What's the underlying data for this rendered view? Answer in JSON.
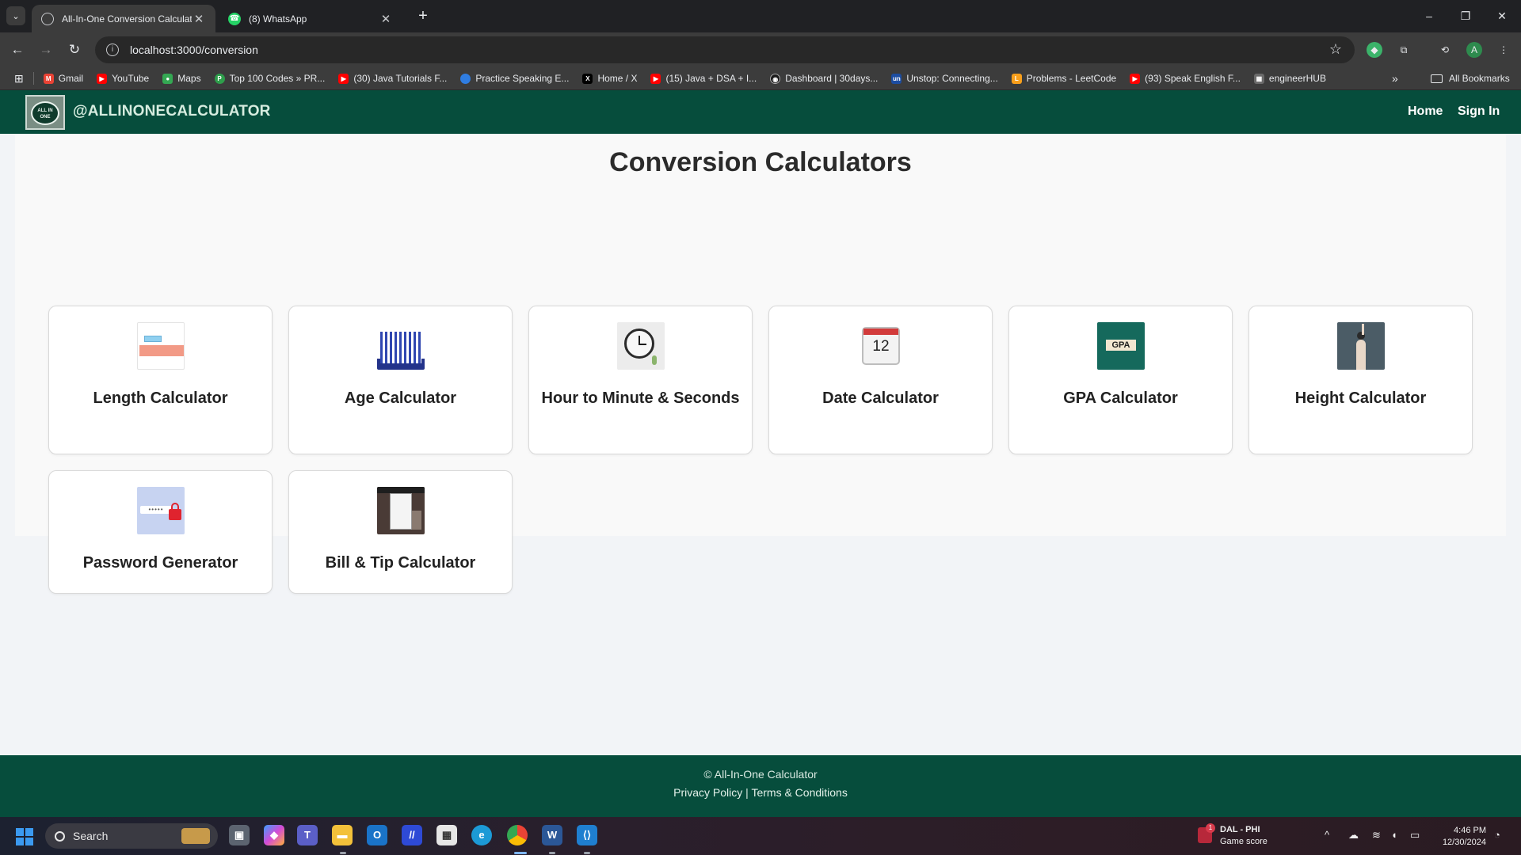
{
  "browser": {
    "tabs": [
      {
        "title": "All-In-One Conversion Calculat",
        "active": true,
        "icon": "globe-icon"
      },
      {
        "title": "(8) WhatsApp",
        "active": false,
        "icon": "whatsapp-icon"
      }
    ],
    "url": "localhost:3000/conversion",
    "profile_initial": "A",
    "bookmarks": [
      {
        "label": "Gmail",
        "icon": "gmail-icon",
        "color": "#ea4335"
      },
      {
        "label": "YouTube",
        "icon": "youtube-icon",
        "color": "#ff0000"
      },
      {
        "label": "Maps",
        "icon": "maps-icon",
        "color": "#34a853"
      },
      {
        "label": "Top 100 Codes » PR...",
        "icon": "code-icon",
        "color": "#2e9e4b"
      },
      {
        "label": "(30) Java Tutorials F...",
        "icon": "youtube-icon",
        "color": "#ff0000"
      },
      {
        "label": "Practice Speaking E...",
        "icon": "globe-icon",
        "color": "#2f7de1"
      },
      {
        "label": "Home / X",
        "icon": "x-icon",
        "color": "#000000"
      },
      {
        "label": "(15) Java + DSA + I...",
        "icon": "youtube-icon",
        "color": "#ff0000"
      },
      {
        "label": "Dashboard | 30days...",
        "icon": "dashboard-icon",
        "color": "#1b1b1b"
      },
      {
        "label": "Unstop: Connecting...",
        "icon": "unstop-icon",
        "color": "#1c4da1"
      },
      {
        "label": "Problems - LeetCode",
        "icon": "leetcode-icon",
        "color": "#f89f1b"
      },
      {
        "label": "(93) Speak English F...",
        "icon": "youtube-icon",
        "color": "#ff0000"
      },
      {
        "label": "engineerHUB",
        "icon": "hub-icon",
        "color": "#6a6a6a"
      }
    ],
    "all_bookmarks": "All Bookmarks"
  },
  "site": {
    "brand": "@ALLINONECALCULATOR",
    "logo_text": "ALL IN ONE",
    "nav": {
      "home": "Home",
      "sign_in": "Sign In"
    },
    "page_title": "Conversion Calculators",
    "cards": [
      {
        "label": "Length Calculator",
        "icon": "ruler-image"
      },
      {
        "label": "Age Calculator",
        "icon": "age-bars-image"
      },
      {
        "label": "Hour to Minute & Seconds",
        "icon": "clock-image"
      },
      {
        "label": "Date Calculator",
        "icon": "calendar-image",
        "icon_text": "12"
      },
      {
        "label": "GPA Calculator",
        "icon": "gpa-image",
        "icon_text": "GPA"
      },
      {
        "label": "Height Calculator",
        "icon": "height-image"
      },
      {
        "label": "Password Generator",
        "icon": "password-lock-image"
      },
      {
        "label": "Bill & Tip Calculator",
        "icon": "bill-image"
      }
    ],
    "footer": {
      "copyright": "© All-In-One Calculator",
      "privacy": "Privacy Policy",
      "separator": "|",
      "terms": "Terms & Conditions"
    },
    "colors": {
      "header": "#064d3c",
      "footer": "#064d3c"
    }
  },
  "taskbar": {
    "search_placeholder": "Search",
    "news_title": "DAL - PHI",
    "news_subtitle": "Game score",
    "news_badge": "1",
    "time": "4:46 PM",
    "date": "12/30/2024"
  }
}
